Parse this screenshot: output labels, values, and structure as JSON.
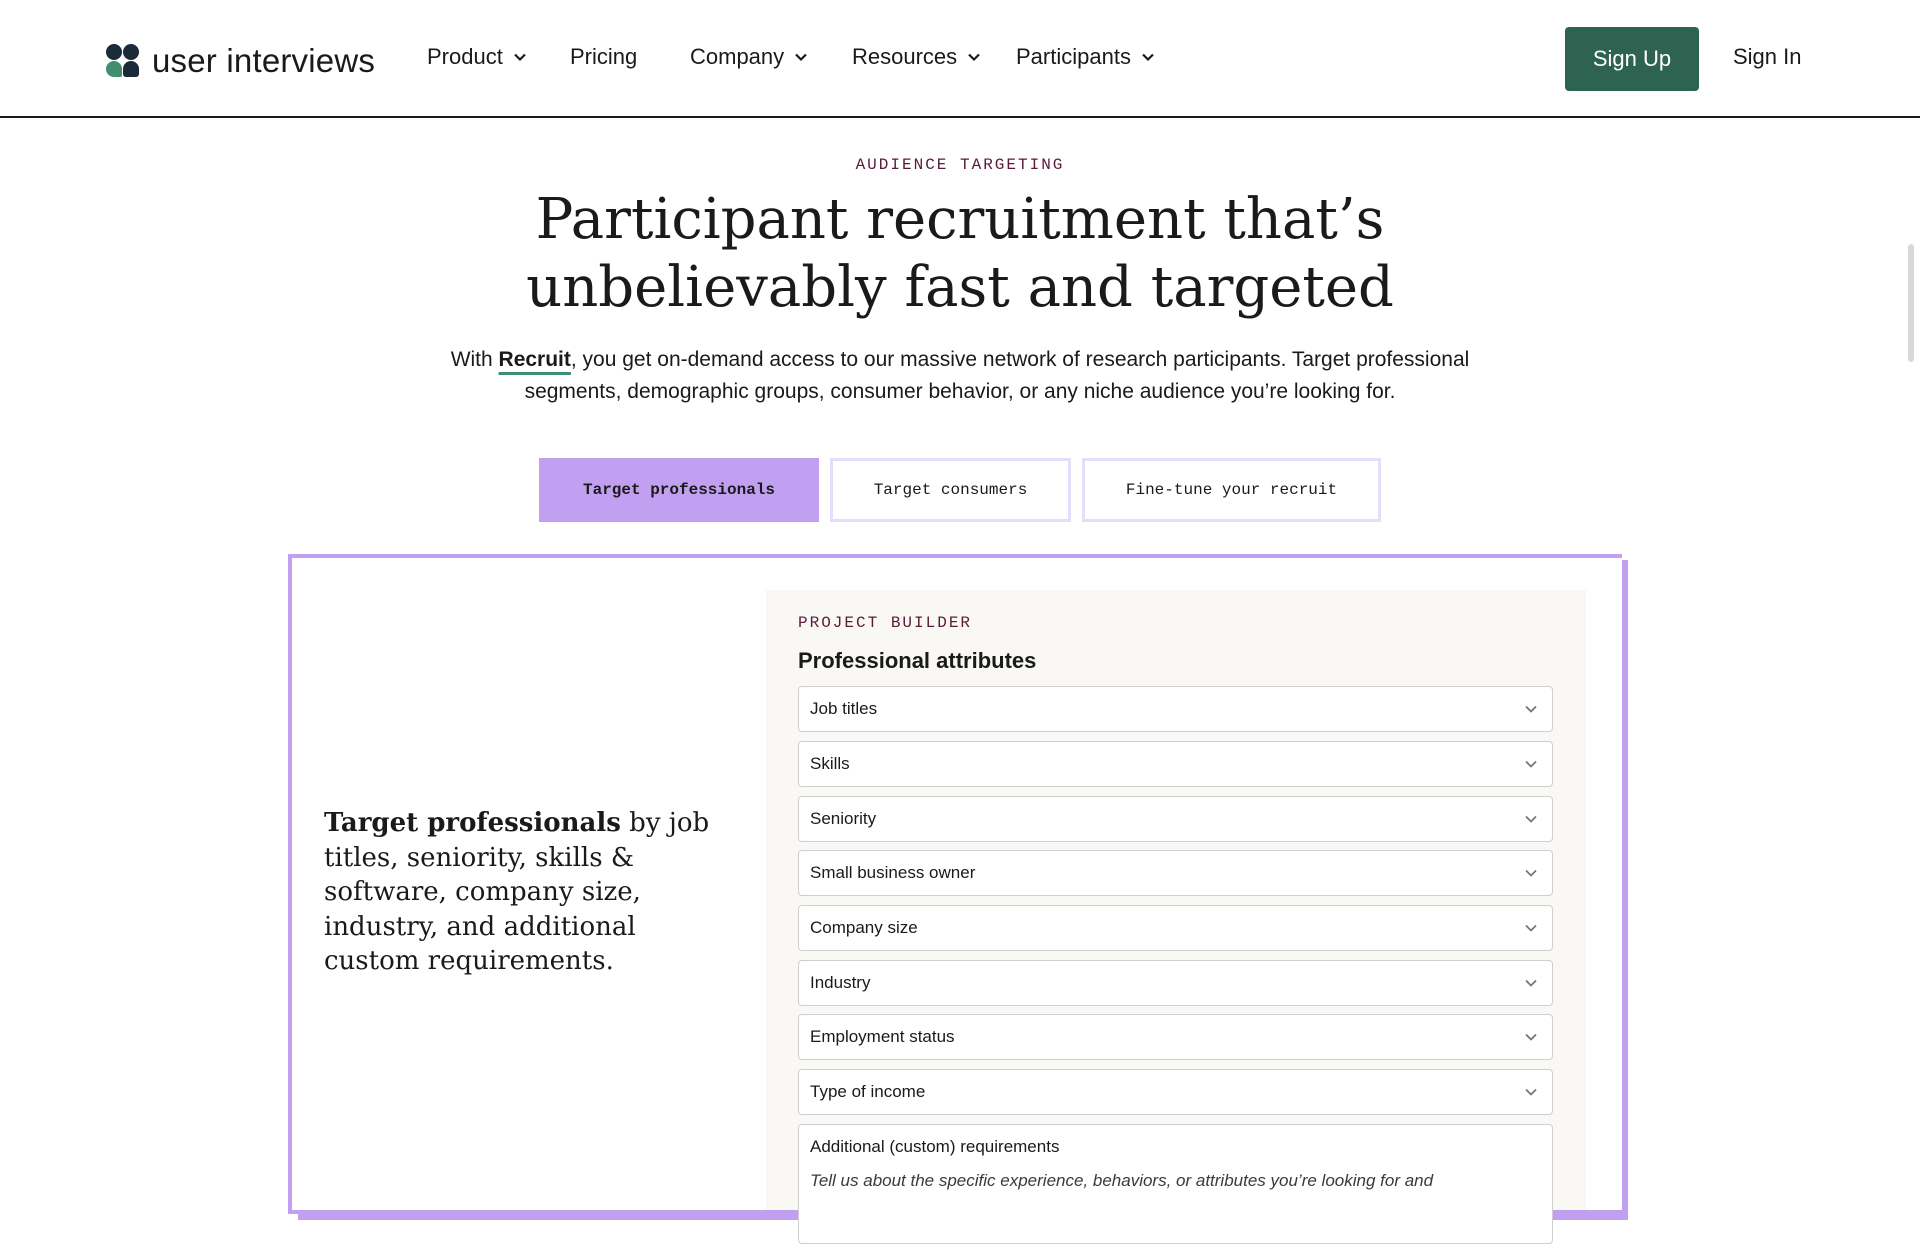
{
  "header": {
    "logo_text": "user interviews",
    "nav": [
      {
        "label": "Product",
        "has_dropdown": true
      },
      {
        "label": "Pricing",
        "has_dropdown": false
      },
      {
        "label": "Company",
        "has_dropdown": true
      },
      {
        "label": "Resources",
        "has_dropdown": true
      },
      {
        "label": "Participants",
        "has_dropdown": true
      }
    ],
    "signup_label": "Sign Up",
    "signin_label": "Sign In",
    "accent_color": "#2e6352"
  },
  "hero": {
    "eyebrow": "AUDIENCE TARGETING",
    "title_line1": "Participant recruitment that’s",
    "title_line2": "unbelievably fast and targeted",
    "sub_prefix": "With ",
    "sub_link": "Recruit",
    "sub_line1_rest": ", you get on-demand access to our massive network of research participants. Target professional",
    "sub_line2": "segments, demographic groups, consumer behavior, or any niche audience you’re looking for."
  },
  "tabs": [
    {
      "label": "Target professionals",
      "active": true
    },
    {
      "label": "Target consumers",
      "active": false
    },
    {
      "label": "Fine-tune your recruit",
      "active": false
    }
  ],
  "panel": {
    "desc_bold": "Target professionals",
    "desc_rest": " by job titles, seniority, skills & software, company size, industry, and additional custom requirements.",
    "builder": {
      "eyebrow": "PROJECT BUILDER",
      "title": "Professional attributes",
      "fields": [
        "Job titles",
        "Skills",
        "Seniority",
        "Small business owner",
        "Company size",
        "Industry",
        "Employment status",
        "Type of income"
      ],
      "custom_label": "Additional (custom) requirements",
      "custom_placeholder": "Tell us about the specific experience, behaviors, or attributes you’re looking for and"
    },
    "accent_color": "#c1a0f2"
  }
}
